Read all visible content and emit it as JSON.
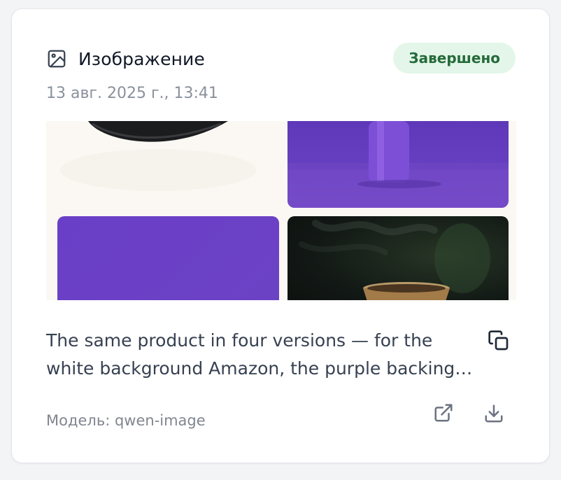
{
  "card": {
    "type_label": "Изображение",
    "type_icon": "image-icon",
    "status": "Завершено",
    "timestamp": "13 авг. 2025 г., 13:41",
    "description": "The same product in four versions — for the white background Amazon, the purple backing for social networks, a lifestyle scene with steam, and a flat purple banner.",
    "model": "Модель: qwen-image",
    "icons": {
      "copy": "copy-icon",
      "open": "external-link-icon",
      "download": "download-icon"
    },
    "colors": {
      "status_bg": "#e3f6e9",
      "status_text": "#256a3a",
      "accent_purple": "#6a3fc7"
    }
  }
}
